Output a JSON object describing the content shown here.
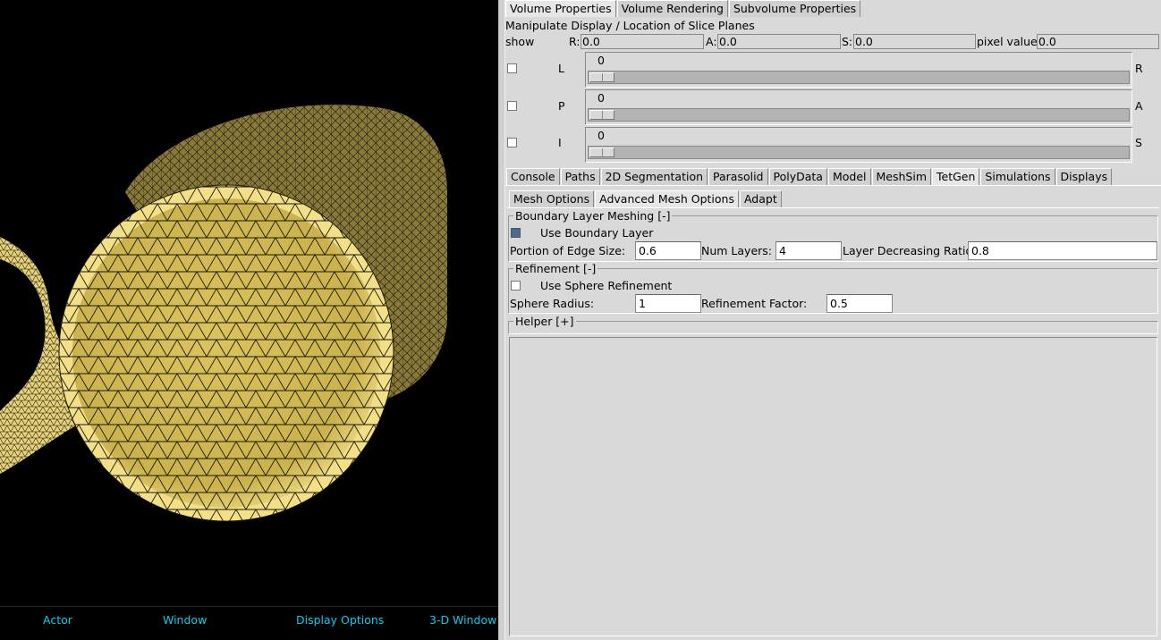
{
  "viewport_bar": {
    "actor": "Actor",
    "window": "Window",
    "display_options": "Display Options",
    "three_d_window": "3-D Window"
  },
  "volume_tabs": [
    "Volume Properties",
    "Volume Rendering",
    "Subvolume Properties"
  ],
  "slice_planes": {
    "title": "Manipulate Display / Location of Slice Planes",
    "show_label": "show",
    "r_label": "R:",
    "r_value": "0.0",
    "a_label": "A:",
    "a_value": "0.0",
    "s_label": "S:",
    "s_value": "0.0",
    "pixel_label": "pixel value:",
    "pixel_value": "0.0",
    "sliders": [
      {
        "left": "L",
        "right": "R",
        "value": "0"
      },
      {
        "left": "P",
        "right": "A",
        "value": "0"
      },
      {
        "left": "I",
        "right": "S",
        "value": "0"
      }
    ]
  },
  "main_tabs": [
    "Console",
    "Paths",
    "2D Segmentation",
    "Parasolid",
    "PolyData",
    "Model",
    "MeshSim",
    "TetGen",
    "Simulations",
    "Displays"
  ],
  "main_tab_active": "TetGen",
  "sub_tabs": [
    "Mesh Options",
    "Advanced Mesh Options",
    "Adapt"
  ],
  "sub_tab_active": "Advanced Mesh Options",
  "boundary_layer": {
    "title": "Boundary Layer Meshing [-]",
    "use_label": "Use Boundary Layer",
    "use_checked": true,
    "edge_label": "Portion of Edge Size:",
    "edge_value": "0.6",
    "layers_label": "Num Layers:",
    "layers_value": "4",
    "ratio_label": "Layer Decreasing Ratio:",
    "ratio_value": "0.8"
  },
  "refinement": {
    "title": "Refinement [-]",
    "use_label": "Use Sphere Refinement",
    "use_checked": false,
    "radius_label": "Sphere Radius:",
    "radius_value": "1",
    "factor_label": "Refinement Factor:",
    "factor_value": "0.5"
  },
  "helper": {
    "title": "Helper [+]"
  },
  "colors": {
    "mesh_fill": "#d4bd5a",
    "mesh_back": "#8a7a3a",
    "bar_text": "#00d0f0"
  }
}
